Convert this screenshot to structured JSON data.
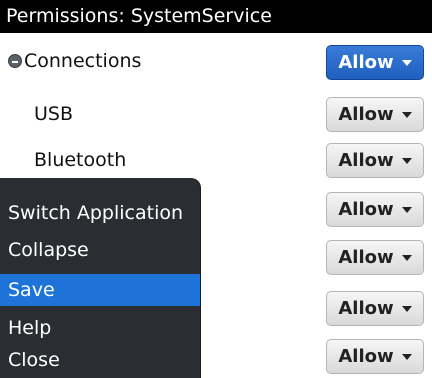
{
  "title": "Permissions: SystemService",
  "section": {
    "label": "Connections",
    "icon": "collapse-icon"
  },
  "rows": [
    {
      "label": "Connections",
      "value": "Allow",
      "selected": true
    },
    {
      "label": "USB",
      "value": "Allow",
      "selected": false
    },
    {
      "label": "Bluetooth",
      "value": "Allow",
      "selected": false
    },
    {
      "label": "",
      "value": "Allow",
      "selected": false
    },
    {
      "label": "",
      "value": "Allow",
      "selected": false
    },
    {
      "label": "",
      "value": "Allow",
      "selected": false
    },
    {
      "label": "",
      "value": "Allow",
      "selected": false
    }
  ],
  "menu": {
    "items": [
      {
        "label": "Switch Application",
        "selected": false
      },
      {
        "label": "Collapse",
        "selected": false
      },
      {
        "label": "Save",
        "selected": true
      },
      {
        "label": "Help",
        "selected": false
      },
      {
        "label": "Close",
        "selected": false
      }
    ]
  },
  "colors": {
    "selection_blue": "#1e73d9",
    "titlebar": "#000000",
    "menu_background": "#2a2d31"
  }
}
